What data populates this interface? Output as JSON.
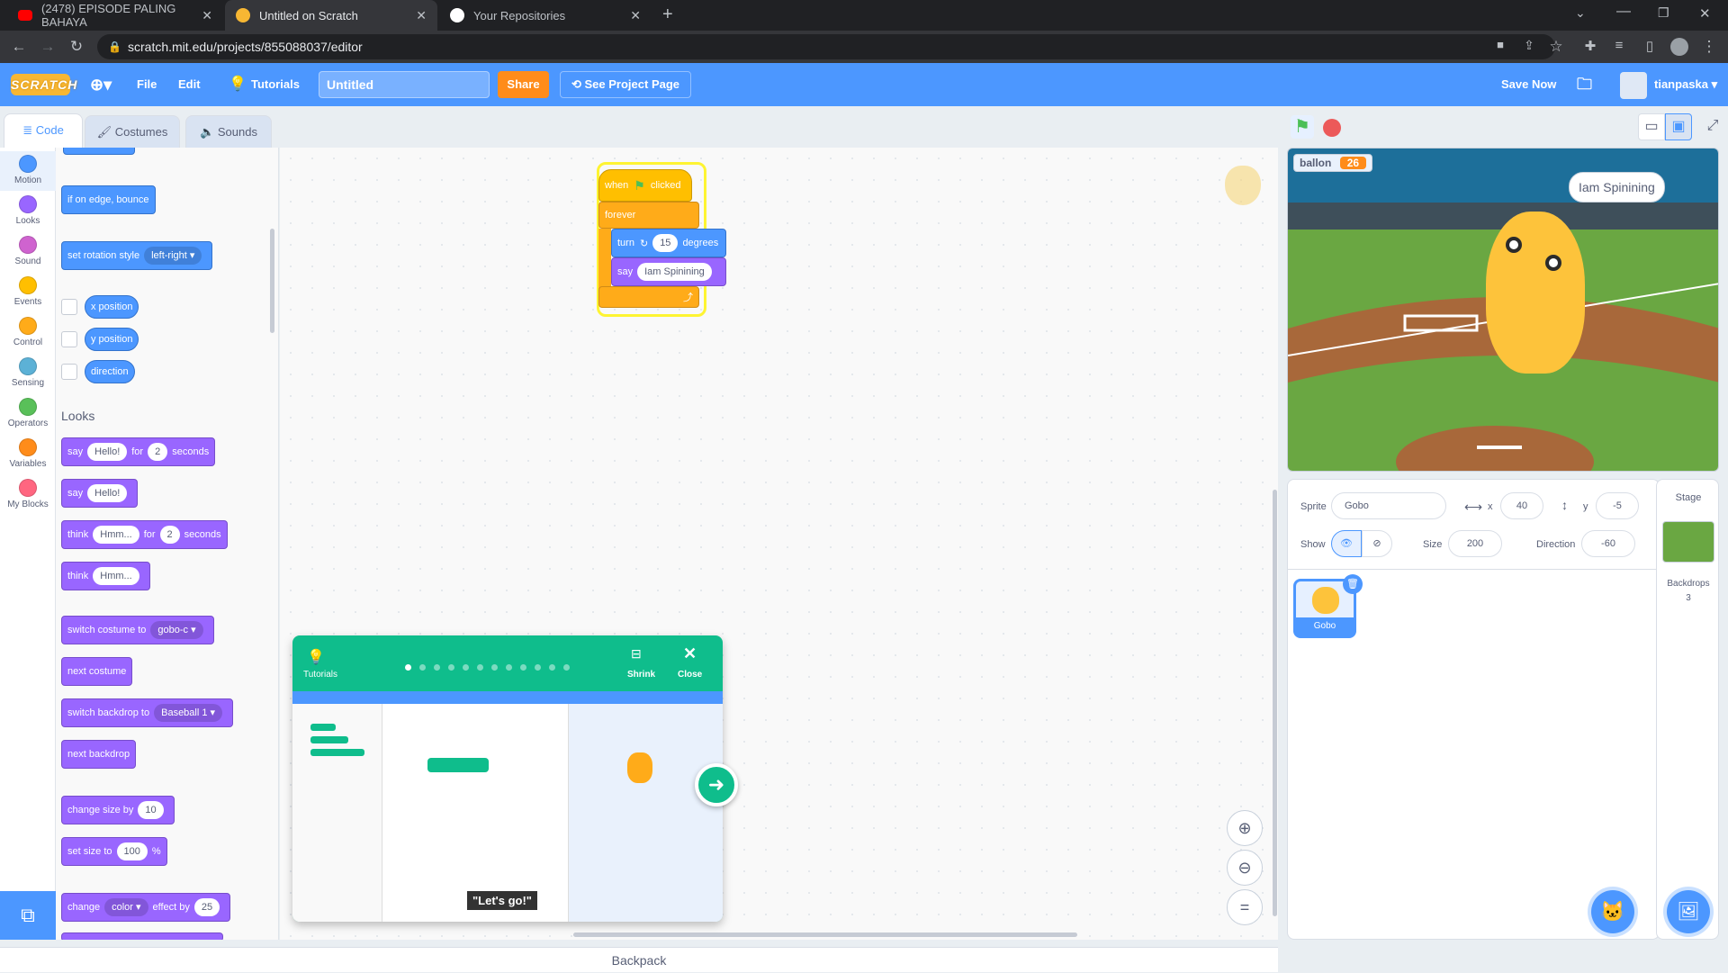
{
  "browser": {
    "tabs": [
      {
        "title": "(2478) EPISODE PALING BAHAYA",
        "icon": "youtube-icon"
      },
      {
        "title": "Untitled on Scratch",
        "icon": "scratch-icon"
      },
      {
        "title": "Your Repositories",
        "icon": "github-icon"
      }
    ],
    "url": "scratch.mit.edu/projects/855088037/editor"
  },
  "menu": {
    "logo": "SCRATCH",
    "file": "File",
    "edit": "Edit",
    "tutorials": "Tutorials",
    "project_title": "Untitled",
    "share": "Share",
    "see_project": "See Project Page",
    "save_now": "Save Now",
    "username": "tianpaska"
  },
  "editor_tabs": [
    "Code",
    "Costumes",
    "Sounds"
  ],
  "categories": [
    {
      "label": "Motion",
      "color": "#4c97ff"
    },
    {
      "label": "Looks",
      "color": "#9966ff"
    },
    {
      "label": "Sound",
      "color": "#cf63cf"
    },
    {
      "label": "Events",
      "color": "#ffbf00"
    },
    {
      "label": "Control",
      "color": "#ffab19"
    },
    {
      "label": "Sensing",
      "color": "#5cb1d6"
    },
    {
      "label": "Operators",
      "color": "#59c059"
    },
    {
      "label": "Variables",
      "color": "#ff8c1a"
    },
    {
      "label": "My Blocks",
      "color": "#ff6680"
    }
  ],
  "palette": {
    "if_on_edge": "if on edge, bounce",
    "set_rotation": "set rotation style",
    "rotation_value": "left-right",
    "x_position": "x position",
    "y_position": "y position",
    "direction": "direction",
    "looks_heading": "Looks",
    "say": "say",
    "hello": "Hello!",
    "for": "for",
    "two": "2",
    "seconds": "seconds",
    "think": "think",
    "hmm": "Hmm...",
    "switch_costume": "switch costume to",
    "costume_value": "gobo-c",
    "next_costume": "next costume",
    "switch_backdrop": "switch backdrop to",
    "backdrop_value": "Baseball 1",
    "next_backdrop": "next backdrop",
    "change_size": "change size by",
    "size_by": "10",
    "set_size": "set size to",
    "size_to": "100",
    "percent": "%",
    "change": "change",
    "effect": "color",
    "effect_by": "effect by",
    "effect_value": "25"
  },
  "script": {
    "when": "when",
    "clicked": "clicked",
    "forever": "forever",
    "turn": "turn",
    "degrees_value": "15",
    "degrees": "degrees",
    "say": "say",
    "say_text": "Iam Spinining"
  },
  "tutorial": {
    "label": "Tutorials",
    "shrink": "Shrink",
    "close": "Close",
    "caption": "\"Let's go!\"",
    "step_count": 12,
    "current_step": 1
  },
  "stage": {
    "variable_name": "ballon",
    "variable_value": "26",
    "speech": "Iam Spinining"
  },
  "sprite_info": {
    "sprite_label": "Sprite",
    "sprite_name": "Gobo",
    "x_label": "x",
    "x_value": "40",
    "y_label": "y",
    "y_value": "-5",
    "show_label": "Show",
    "size_label": "Size",
    "size_value": "200",
    "direction_label": "Direction",
    "direction_value": "-60",
    "selected_sprite": "Gobo"
  },
  "stage_panel": {
    "title": "Stage",
    "backdrops_label": "Backdrops",
    "backdrops_count": "3"
  },
  "backpack": "Backpack"
}
